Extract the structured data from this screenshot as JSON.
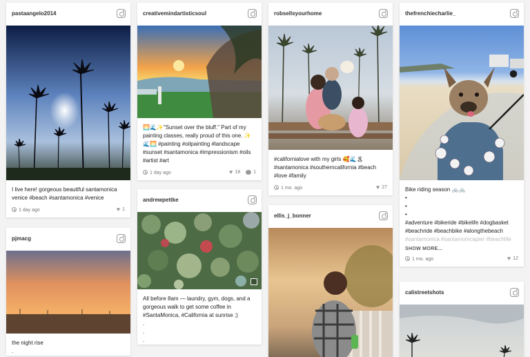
{
  "posts": [
    {
      "username": "pastaangelo2014",
      "caption": "I live here! gorgeous beautiful santamonica venice #beach #santamonica #venice",
      "time": "1 day ago",
      "likes": "1"
    },
    {
      "username": "pjmacg",
      "caption": "the night rise",
      "caption_tail": "."
    },
    {
      "username": "creativemindartisticsoul",
      "caption": "🌅🌊✨\"Sunset over the bluff.\" Part of my painting classes, really proud of this one. ✨🌊🌅 #painting #oilpainting #landscape #sunset #santamonica #impressionism #oils #artist #art",
      "time": "1 day ago",
      "likes": "18",
      "comments": "1"
    },
    {
      "username": "andrewpettke",
      "caption": "All before 8am — laundry, gym, dogs, and a gorgeous walk to get some coffee in #SantaMonica, #California at sunrise ;)",
      "caption_tail": ".\n.\n."
    },
    {
      "username": "robsellsyourhome",
      "caption": "#californialove with my girls 🥰🌊🏝 #santamonica #southerncalifornia #beach #love #family",
      "time": "1 mo. ago",
      "likes": "27"
    },
    {
      "username": "ellis_j_bonner"
    },
    {
      "username": "thefrenchiecharlie_",
      "caption": "Bike riding season 🚲🚲\n•\n•\n•\n#adventure #bikeride #bikelife #dogbasket #beachride #beachbike #alongthebeach",
      "caption_muted": "#santamonica #santamonicapier #beachlife #summer #frenchie #frenchbulldog",
      "show_more": "SHOW MORE...",
      "time": "1 mo. ago",
      "likes": "12"
    },
    {
      "username": "calistreetshots"
    }
  ],
  "icons": {
    "instagram": "instagram-icon",
    "clock": "clock-icon",
    "heart": "heart-icon",
    "comment": "comment-icon",
    "gallery": "gallery-icon"
  },
  "colors": {
    "background": "#f3f3f3",
    "card": "#ffffff",
    "muted_text": "#777777"
  }
}
